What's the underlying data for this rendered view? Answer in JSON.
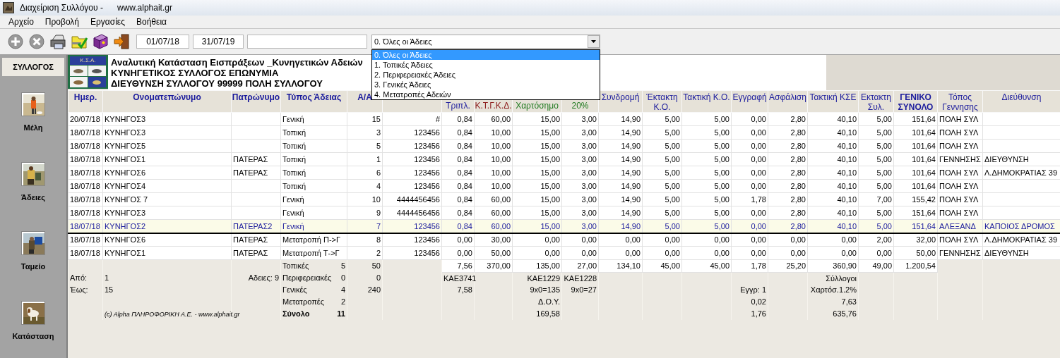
{
  "window": {
    "title": "Διαχείριση Συλλόγου -",
    "url": "www.alphait.gr"
  },
  "menu": [
    {
      "label": "Αρχείο"
    },
    {
      "label": "Προβολή"
    },
    {
      "label": "Εργασίες"
    },
    {
      "label": "Βοήθεια"
    }
  ],
  "toolbar": {
    "buttons": [
      {
        "kind": "add"
      },
      {
        "kind": "delete"
      },
      {
        "kind": "print"
      },
      {
        "kind": "folder"
      },
      {
        "kind": "help"
      },
      {
        "kind": "exit"
      }
    ],
    "date_from": "01/07/18",
    "date_to": "31/07/19",
    "filter": {
      "value": "0. Όλες οι Άδειες",
      "expanded": true,
      "options": [
        {
          "label": "0. Όλες οι Άδειες",
          "selected": true
        },
        {
          "label": "1. Τοπικές Άδειες",
          "selected": false
        },
        {
          "label": "2. Περιφερειακές Άδειες",
          "selected": false
        },
        {
          "label": "3. Γενικές Άδειες",
          "selected": false
        },
        {
          "label": "4. Μετατροπές Αδειών",
          "selected": false
        }
      ]
    }
  },
  "sidebar": {
    "title": "ΣΥΛΛΟΓΟΣ",
    "items": [
      {
        "label": "Μέλη"
      },
      {
        "label": "Άδειες"
      },
      {
        "label": "Ταμείο"
      },
      {
        "label": "Κατάσταση"
      }
    ]
  },
  "report": {
    "logo": "Κ.Σ.Α.",
    "lines": [
      "Αναλυτική Κατάσταση Εισπράξεων _Κυνηγετικών Αδειών",
      "ΚΥΝΗΓΕΤΙΚΟΣ ΣΥΛΛΟΓΟΣ ΕΠΩΝΥΜΙΑ",
      "ΔΙΕΥΘΥΝΣΗ ΣΥΛΛΟΓΟΥ 99999 ΠΟΛΗ ΣΥΛΛΟΓΟΥ"
    ]
  },
  "table": {
    "columns": [
      {
        "lines": [
          "Ημερ."
        ],
        "color": "#1a1a9c",
        "kind": "bold"
      },
      {
        "lines": [
          "Ονοματεπώνυμο"
        ],
        "color": "#1a1a9c",
        "kind": "bold"
      },
      {
        "lines": [
          "Πατρώνυμο"
        ],
        "color": "#1a1a9c",
        "kind": "bold"
      },
      {
        "lines": [
          "Τύπος Άδειας"
        ],
        "color": "#1a1a9c",
        "kind": "bold"
      },
      {
        "lines": [
          "Α/Α"
        ],
        "color": "#1a1a9c",
        "kind": "bold"
      },
      {
        "kind": "covered"
      },
      {
        "lines": [
          "Τριπλ."
        ],
        "color": "#1a1a9c",
        "kind": "partial"
      },
      {
        "lines": [
          "Κ.Τ.Γ.Κ.Δ."
        ],
        "color": "#8b1a1a",
        "kind": "partial"
      },
      {
        "lines": [
          "Χαρτόσημο"
        ],
        "color": "#1f7a1f",
        "kind": "partial"
      },
      {
        "lines": [
          "20%"
        ],
        "color": "#1f7a1f",
        "kind": "partial"
      },
      {
        "lines": [
          "Συνδρομή"
        ],
        "color": "#1a1a9c",
        "kind": "plain"
      },
      {
        "lines": [
          "Έκτακτη",
          "Κ.Ο."
        ],
        "color": "#1a1a9c",
        "kind": "plain"
      },
      {
        "lines": [
          "Τακτική Κ.Ο."
        ],
        "color": "#1a1a9c",
        "kind": "plain"
      },
      {
        "lines": [
          "Εγγραφή"
        ],
        "color": "#1a1a9c",
        "kind": "plain"
      },
      {
        "lines": [
          "Ασφάλιση"
        ],
        "color": "#1a1a9c",
        "kind": "plain"
      },
      {
        "lines": [
          "Τακτική ΚΣΕ"
        ],
        "color": "#1a1a9c",
        "kind": "plain"
      },
      {
        "lines": [
          "Εκτακτη",
          "Συλ."
        ],
        "color": "#1a1a9c",
        "kind": "plain"
      },
      {
        "lines": [
          "ΓΕΝΙΚΟ",
          "ΣΥΝΟΛΟ"
        ],
        "color": "#1a1a9c",
        "kind": "bold"
      },
      {
        "lines": [
          "Τόπος",
          "Γεννησης"
        ],
        "color": "#1a1a9c",
        "kind": "plain"
      },
      {
        "lines": [
          "Διεύθυνση"
        ],
        "color": "#1a1a9c",
        "kind": "plain"
      }
    ],
    "rows": [
      {
        "selected": false,
        "cells": [
          "20/07/18",
          "ΚΥΝΗΓΟΣ3",
          "",
          "Γενική",
          "15",
          "#",
          "0,84",
          "60,00",
          "15,00",
          "3,00",
          "14,90",
          "5,00",
          "5,00",
          "0,00",
          "2,80",
          "40,10",
          "5,00",
          "151,64",
          "ΠΟΛΗ ΣΥΛ",
          ""
        ]
      },
      {
        "selected": false,
        "cells": [
          "18/07/18",
          "ΚΥΝΗΓΟΣ3",
          "",
          "Τοπική",
          "3",
          "123456",
          "0,84",
          "10,00",
          "15,00",
          "3,00",
          "14,90",
          "5,00",
          "5,00",
          "0,00",
          "2,80",
          "40,10",
          "5,00",
          "101,64",
          "ΠΟΛΗ ΣΥΛ",
          ""
        ]
      },
      {
        "selected": false,
        "cells": [
          "18/07/18",
          "ΚΥΝΗΓΟΣ5",
          "",
          "Τοπική",
          "5",
          "123456",
          "0,84",
          "10,00",
          "15,00",
          "3,00",
          "14,90",
          "5,00",
          "5,00",
          "0,00",
          "2,80",
          "40,10",
          "5,00",
          "101,64",
          "ΠΟΛΗ ΣΥΛ",
          ""
        ]
      },
      {
        "selected": false,
        "cells": [
          "18/07/18",
          "ΚΥΝΗΓΟΣ1",
          "ΠΑΤΕΡΑΣ",
          "Τοπική",
          "1",
          "123456",
          "0,84",
          "10,00",
          "15,00",
          "3,00",
          "14,90",
          "5,00",
          "5,00",
          "0,00",
          "2,80",
          "40,10",
          "5,00",
          "101,64",
          "ΓΕΝΝΗΣΗΣ",
          "ΔΙΕΥΘΥΝΣΗ"
        ]
      },
      {
        "selected": false,
        "cells": [
          "18/07/18",
          "ΚΥΝΗΓΟΣ6",
          "ΠΑΤΕΡΑΣ",
          "Τοπική",
          "6",
          "123456",
          "0,84",
          "10,00",
          "15,00",
          "3,00",
          "14,90",
          "5,00",
          "5,00",
          "0,00",
          "2,80",
          "40,10",
          "5,00",
          "101,64",
          "ΠΟΛΗ ΣΥΛ",
          "Λ.ΔΗΜΟΚΡΑΤΙΑΣ 39"
        ]
      },
      {
        "selected": false,
        "cells": [
          "18/07/18",
          "ΚΥΝΗΓΟΣ4",
          "",
          "Τοπική",
          "4",
          "123456",
          "0,84",
          "10,00",
          "15,00",
          "3,00",
          "14,90",
          "5,00",
          "5,00",
          "0,00",
          "2,80",
          "40,10",
          "5,00",
          "101,64",
          "ΠΟΛΗ ΣΥΛ",
          ""
        ]
      },
      {
        "selected": false,
        "cells": [
          "18/07/18",
          "ΚΥΝΗΓΟΣ 7",
          "",
          "Γενική",
          "10",
          "4444456456",
          "0,84",
          "60,00",
          "15,00",
          "3,00",
          "14,90",
          "5,00",
          "5,00",
          "1,78",
          "2,80",
          "40,10",
          "7,00",
          "155,42",
          "ΠΟΛΗ ΣΥΛ",
          ""
        ]
      },
      {
        "selected": false,
        "cells": [
          "18/07/18",
          "ΚΥΝΗΓΟΣ3",
          "",
          "Γενική",
          "9",
          "4444456456",
          "0,84",
          "60,00",
          "15,00",
          "3,00",
          "14,90",
          "5,00",
          "5,00",
          "0,00",
          "2,80",
          "40,10",
          "5,00",
          "151,64",
          "ΠΟΛΗ ΣΥΛ",
          ""
        ]
      },
      {
        "selected": true,
        "cells": [
          "18/07/18",
          "ΚΥΝΗΓΟΣ2",
          "ΠΑΤΕΡΑΣ2",
          "Γενική",
          "7",
          "123456",
          "0,84",
          "60,00",
          "15,00",
          "3,00",
          "14,90",
          "5,00",
          "5,00",
          "0,00",
          "2,80",
          "40,10",
          "5,00",
          "151,64",
          "ΑΛΕΞΑΝΔ",
          "ΚΑΠΟΙΟΣ ΔΡΟΜΟΣ"
        ]
      },
      {
        "selected": false,
        "cells": [
          "18/07/18",
          "ΚΥΝΗΓΟΣ6",
          "ΠΑΤΕΡΑΣ",
          "Μετατροπή Π->Γ",
          "8",
          "123456",
          "0,00",
          "30,00",
          "0,00",
          "0,00",
          "0,00",
          "0,00",
          "0,00",
          "0,00",
          "0,00",
          "0,00",
          "2,00",
          "32,00",
          "ΠΟΛΗ ΣΥΛ",
          "Λ.ΔΗΜΟΚΡΑΤΙΑΣ 39"
        ]
      },
      {
        "selected": false,
        "cells": [
          "18/07/18",
          "ΚΥΝΗΓΟΣ1",
          "ΠΑΤΕΡΑΣ",
          "Μετατροπή Τ->Γ",
          "2",
          "123456",
          "0,00",
          "50,00",
          "0,00",
          "0,00",
          "0,00",
          "0,00",
          "0,00",
          "0,00",
          "0,00",
          "0,00",
          "0,00",
          "50,00",
          "ΓΕΝΝΗΣΗΣ",
          "ΔΙΕΥΘΥΝΣΗ"
        ]
      }
    ],
    "summary": [
      {
        "kind": "totals",
        "type": {
          "text": "Τοπικές",
          "count": "5"
        },
        "aa": "50",
        "tripl": "7,56",
        "ktgkd": "370,00",
        "stamp": "135,00",
        "vat": "27,00",
        "subscription": "134,10",
        "extra_ko": "45,00",
        "regular_ko": "45,00",
        "registration": "1,78",
        "insurance": "25,20",
        "regular_kse": "360,90",
        "extra_syl": "49,00",
        "total": "1.200,54"
      },
      {
        "kind": "notes",
        "date": "Από:",
        "name": "1",
        "father": "Αδειες: 9",
        "type": {
          "text": "Περιφερειακές",
          "count": "0"
        },
        "aa": "0",
        "tripl": "ΚΑΕ3741",
        "stamp": "ΚΑΕ1229",
        "vat": "ΚΑΕ1228",
        "regular_kse": "Σύλλογοι"
      },
      {
        "kind": "notes",
        "date": "Έως:",
        "name": "15",
        "type": {
          "text": "Γενικές",
          "count": "4"
        },
        "aa": "240",
        "tripl": "7,58",
        "stamp": "9x0=135",
        "vat": "9x0=27",
        "registration": "Εγγρ: 1",
        "regular_kse": "Χαρτόσ.1.2%"
      },
      {
        "kind": "notes",
        "type": {
          "text": "Μετατροπές",
          "count": "2"
        },
        "stamp": "Δ.Ο.Υ.",
        "registration": "0,02",
        "regular_kse": "7,63"
      },
      {
        "kind": "notes",
        "name": {
          "text": "(c) Alpha ΠΛΗΡΟΦΟΡΙΚΗ Α.Ε. - www.alphait.gr",
          "kind": "credit"
        },
        "type": {
          "text": "Σύνολο",
          "count": "11",
          "kind": "bold"
        },
        "stamp": "169,58",
        "registration": "1,76",
        "regular_kse": "635,76"
      }
    ]
  }
}
